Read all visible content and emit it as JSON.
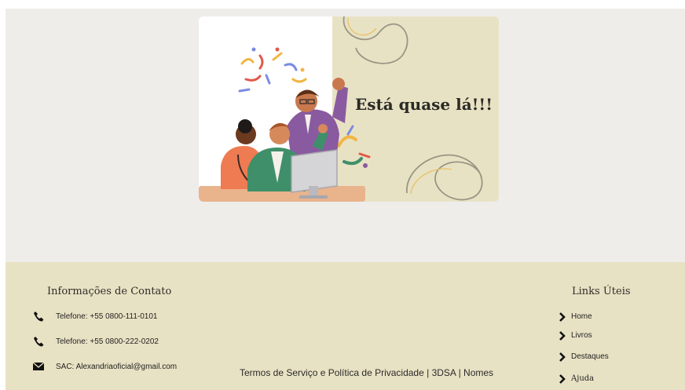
{
  "hero": {
    "title": "Está quase lá!!!"
  },
  "footer": {
    "contact": {
      "title": "Informações de Contato",
      "items": [
        {
          "icon": "phone-icon",
          "text": "Telefone: +55 0800-111-0101"
        },
        {
          "icon": "phone-icon",
          "text": "Telefone: +55 0800-222-0202"
        },
        {
          "icon": "mail-icon",
          "text": "SAC: Alexandriaoficial@gmail.com"
        }
      ]
    },
    "terms": "Termos de Serviço e Política de Privacidade | 3DSA | Nomes",
    "links": {
      "title": "Links Úteis",
      "items": [
        {
          "label": "Home"
        },
        {
          "label": "Livros"
        },
        {
          "label": "Destaques"
        },
        {
          "label": "Ajuda"
        }
      ]
    }
  },
  "colors": {
    "page_bg": "#eeedea",
    "hero_panel": "#e8e2c4",
    "footer_bg": "#e8e2c4",
    "text": "#1f1f1f"
  }
}
